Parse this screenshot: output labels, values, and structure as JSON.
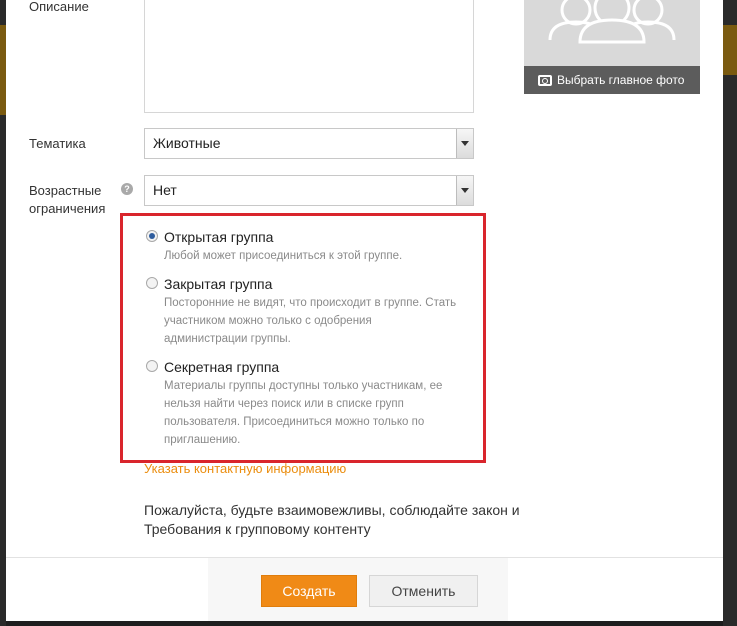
{
  "form": {
    "description_label": "Описание",
    "theme_label": "Тематика",
    "theme_value": "Животные",
    "age_label_line1": "Возрастные",
    "age_label_line2": "ограничения",
    "age_value": "Нет",
    "help_icon_glyph": "?"
  },
  "photo": {
    "choose_main_photo": "Выбрать главное фото",
    "placeholder_icon": "group-people-icon"
  },
  "group_type": {
    "options": [
      {
        "title": "Открытая группа",
        "desc": [
          "Любой может присоединиться к этой группе."
        ],
        "checked": true
      },
      {
        "title": "Закрытая группа",
        "desc": [
          "Посторонние не видят, что происходит в группе. Стать",
          "участником можно только с одобрения",
          "администрации группы."
        ],
        "checked": false
      },
      {
        "title": "Секретная группа",
        "desc": [
          "Материалы группы доступны только участникам, ее",
          "нельзя найти через поиск или в списке групп",
          "пользователя. Присоединиться можно только по",
          "приглашению."
        ],
        "checked": false
      }
    ]
  },
  "contact_link": "Указать контактную информацию",
  "terms": {
    "line1": "Пожалуйста, будьте взаимовежливы, соблюдайте закон и",
    "line2": "Требования к групповому контенту"
  },
  "buttons": {
    "create": "Создать",
    "cancel": "Отменить"
  },
  "colors": {
    "accent_orange": "#f08a16",
    "link_orange": "#eb8e10",
    "highlight_red": "#d9252c",
    "photo_bar": "#5c5c5c"
  }
}
